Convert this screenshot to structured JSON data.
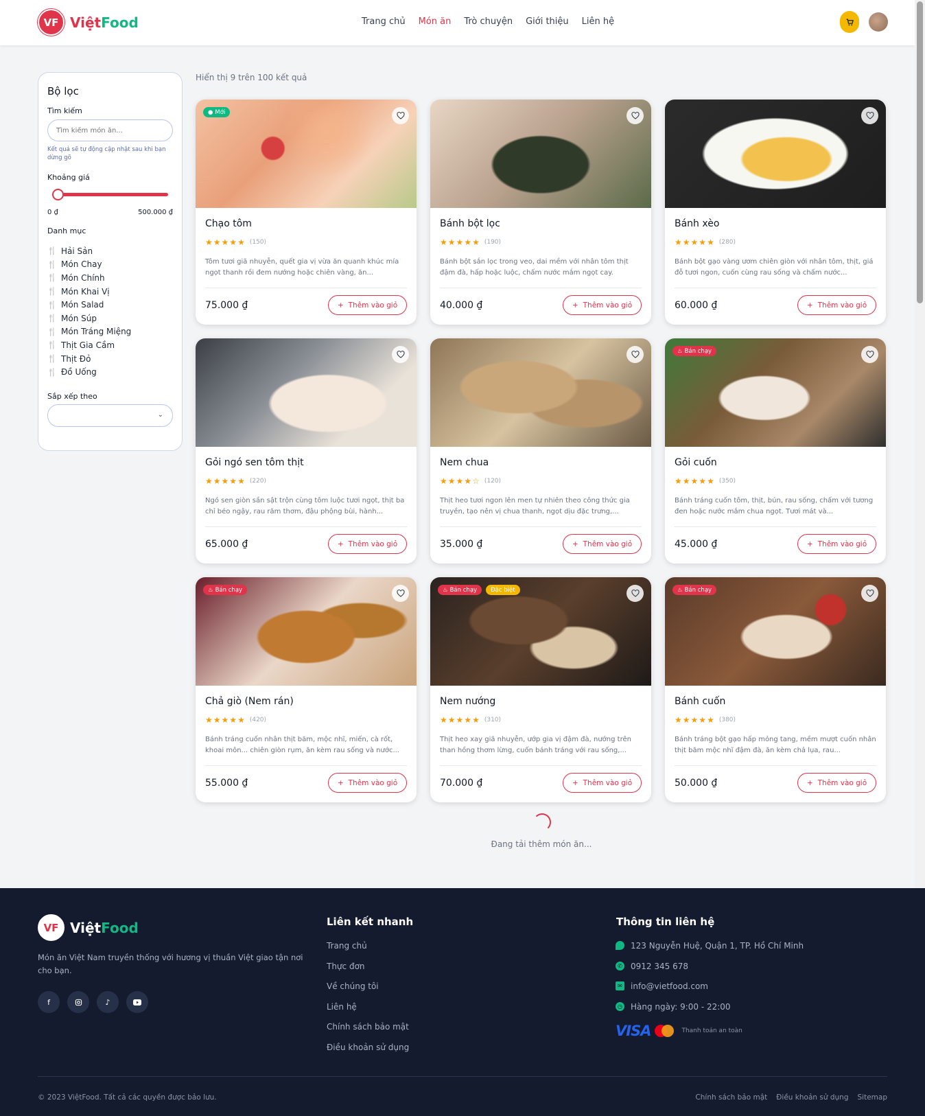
{
  "brand": {
    "badge": "VF",
    "name_a": "Việt",
    "name_b": "Food"
  },
  "nav": [
    "Trang chủ",
    "Món ăn",
    "Trò chuyện",
    "Giới thiệu",
    "Liên hệ"
  ],
  "nav_active_index": 1,
  "filter": {
    "title": "Bộ lọc",
    "search_label": "Tìm kiếm",
    "search_placeholder": "Tìm kiếm món ăn...",
    "search_hint": "Kết quả sẽ tự động cập nhật sau khi bạn dừng gõ",
    "price_label": "Khoảng giá",
    "price_min": "0 ₫",
    "price_max": "500.000 ₫",
    "category_label": "Danh mục",
    "categories": [
      "Hải Sản",
      "Món Chay",
      "Món Chính",
      "Món Khai Vị",
      "Món Salad",
      "Món Súp",
      "Món Tráng Miệng",
      "Thịt Gia Cầm",
      "Thịt Đỏ",
      "Đồ Uống"
    ],
    "sort_label": "Sắp xếp theo",
    "sort_value": ""
  },
  "results_text": "Hiển thị 9 trên 100 kết quả",
  "add_label": "Thêm vào giỏ",
  "products": [
    {
      "name": "Chạo tôm",
      "rating": 4.5,
      "reviews": "(150)",
      "desc": "Tôm tươi giã nhuyễn, quết gia vị vừa ăn quanh khúc mía ngọt thanh rồi đem nướng hoặc chiên vàng, ăn...",
      "price": "75.000 ₫",
      "badges": [
        {
          "text": "Mới",
          "color": "#10b981",
          "icon": "dot"
        }
      ]
    },
    {
      "name": "Bánh bột lọc",
      "rating": 4.5,
      "reviews": "(190)",
      "desc": "Bánh bột sắn lọc trong veo, dai mềm với nhân tôm thịt đậm đà, hấp hoặc luộc, chấm nước mắm ngọt cay.",
      "price": "40.000 ₫",
      "badges": []
    },
    {
      "name": "Bánh xèo",
      "rating": 4.5,
      "reviews": "(280)",
      "desc": "Bánh bột gạo vàng ươm chiên giòn với nhân tôm, thịt, giá đỗ tươi ngon, cuốn cùng rau sống và chấm nước...",
      "price": "60.000 ₫",
      "badges": []
    },
    {
      "name": "Gỏi ngó sen tôm thịt",
      "rating": 4.5,
      "reviews": "(220)",
      "desc": "Ngó sen giòn sần sật trộn cùng tôm luộc tươi ngọt, thịt ba chỉ béo ngậy, rau răm thơm, đậu phộng bùi, hành...",
      "price": "65.000 ₫",
      "badges": []
    },
    {
      "name": "Nem chua",
      "rating": 4,
      "reviews": "(120)",
      "desc": "Thịt heo tươi ngon lên men tự nhiên theo công thức gia truyền, tạo nên vị chua thanh, ngọt dịu đặc trưng,...",
      "price": "35.000 ₫",
      "badges": []
    },
    {
      "name": "Gỏi cuốn",
      "rating": 4.5,
      "reviews": "(350)",
      "desc": "Bánh tráng cuốn tôm, thịt, bún, rau sống, chấm với tương đen hoặc nước mắm chua ngọt. Tươi mát và...",
      "price": "45.000 ₫",
      "badges": [
        {
          "text": "Bán chạy",
          "color": "#e0344b",
          "icon": "fire"
        }
      ]
    },
    {
      "name": "Chả giò (Nem rán)",
      "rating": 4.5,
      "reviews": "(420)",
      "desc": "Bánh tráng cuốn nhân thịt băm, mộc nhĩ, miến, cà rốt, khoai môn... chiên giòn rụm, ăn kèm rau sống và nước...",
      "price": "55.000 ₫",
      "badges": [
        {
          "text": "Bán chạy",
          "color": "#e0344b",
          "icon": "fire"
        }
      ]
    },
    {
      "name": "Nem nướng",
      "rating": 4.5,
      "reviews": "(310)",
      "desc": "Thịt heo xay giã nhuyễn, ướp gia vị đậm đà, nướng trên than hồng thơm lừng, cuốn bánh tráng với rau sống,...",
      "price": "70.000 ₫",
      "badges": [
        {
          "text": "Bán chạy",
          "color": "#e0344b",
          "icon": "fire"
        },
        {
          "text": "Đặc biệt",
          "color": "#f5b800",
          "icon": ""
        }
      ]
    },
    {
      "name": "Bánh cuốn",
      "rating": 4.5,
      "reviews": "(380)",
      "desc": "Bánh tráng bột gạo hấp mỏng tang, mềm mượt cuốn nhân thịt băm mộc nhĩ đậm đà, ăn kèm chả lụa, rau...",
      "price": "50.000 ₫",
      "badges": [
        {
          "text": "Bán chạy",
          "color": "#e0344b",
          "icon": "fire"
        }
      ]
    }
  ],
  "loading_text": "Đang tải thêm món ăn...",
  "footer": {
    "brand_a": "Việt",
    "brand_b": "Food",
    "desc": "Món ăn Việt Nam truyền thống với hương vị thuần Việt giao tận nơi cho bạn.",
    "socials": [
      "facebook-icon",
      "instagram-icon",
      "tiktok-icon",
      "youtube-icon"
    ],
    "quick_title": "Liên kết nhanh",
    "quick_links": [
      "Trang chủ",
      "Thực đơn",
      "Về chúng tôi",
      "Liên hệ",
      "Chính sách bảo mật",
      "Điều khoản sử dụng"
    ],
    "contact_title": "Thông tin liên hệ",
    "contact": {
      "address": "123 Nguyễn Huệ, Quận 1, TP. Hồ Chí Minh",
      "phone": "0912 345 678",
      "email": "info@vietfood.com",
      "hours": "Hàng ngày: 9:00 - 22:00"
    },
    "visa": "VISA",
    "payment_label": "Thanh toán an toàn",
    "copyright": "© 2023 ViệtFood. Tất cả các quyền được bảo lưu.",
    "bottom_links": [
      "Chính sách bảo mật",
      "Điều khoản sử dụng",
      "Sitemap"
    ]
  },
  "colors": {
    "primary": "#e0344b",
    "green": "#10b981",
    "yellow": "#f5b800",
    "footer_bg": "#141b2e"
  }
}
